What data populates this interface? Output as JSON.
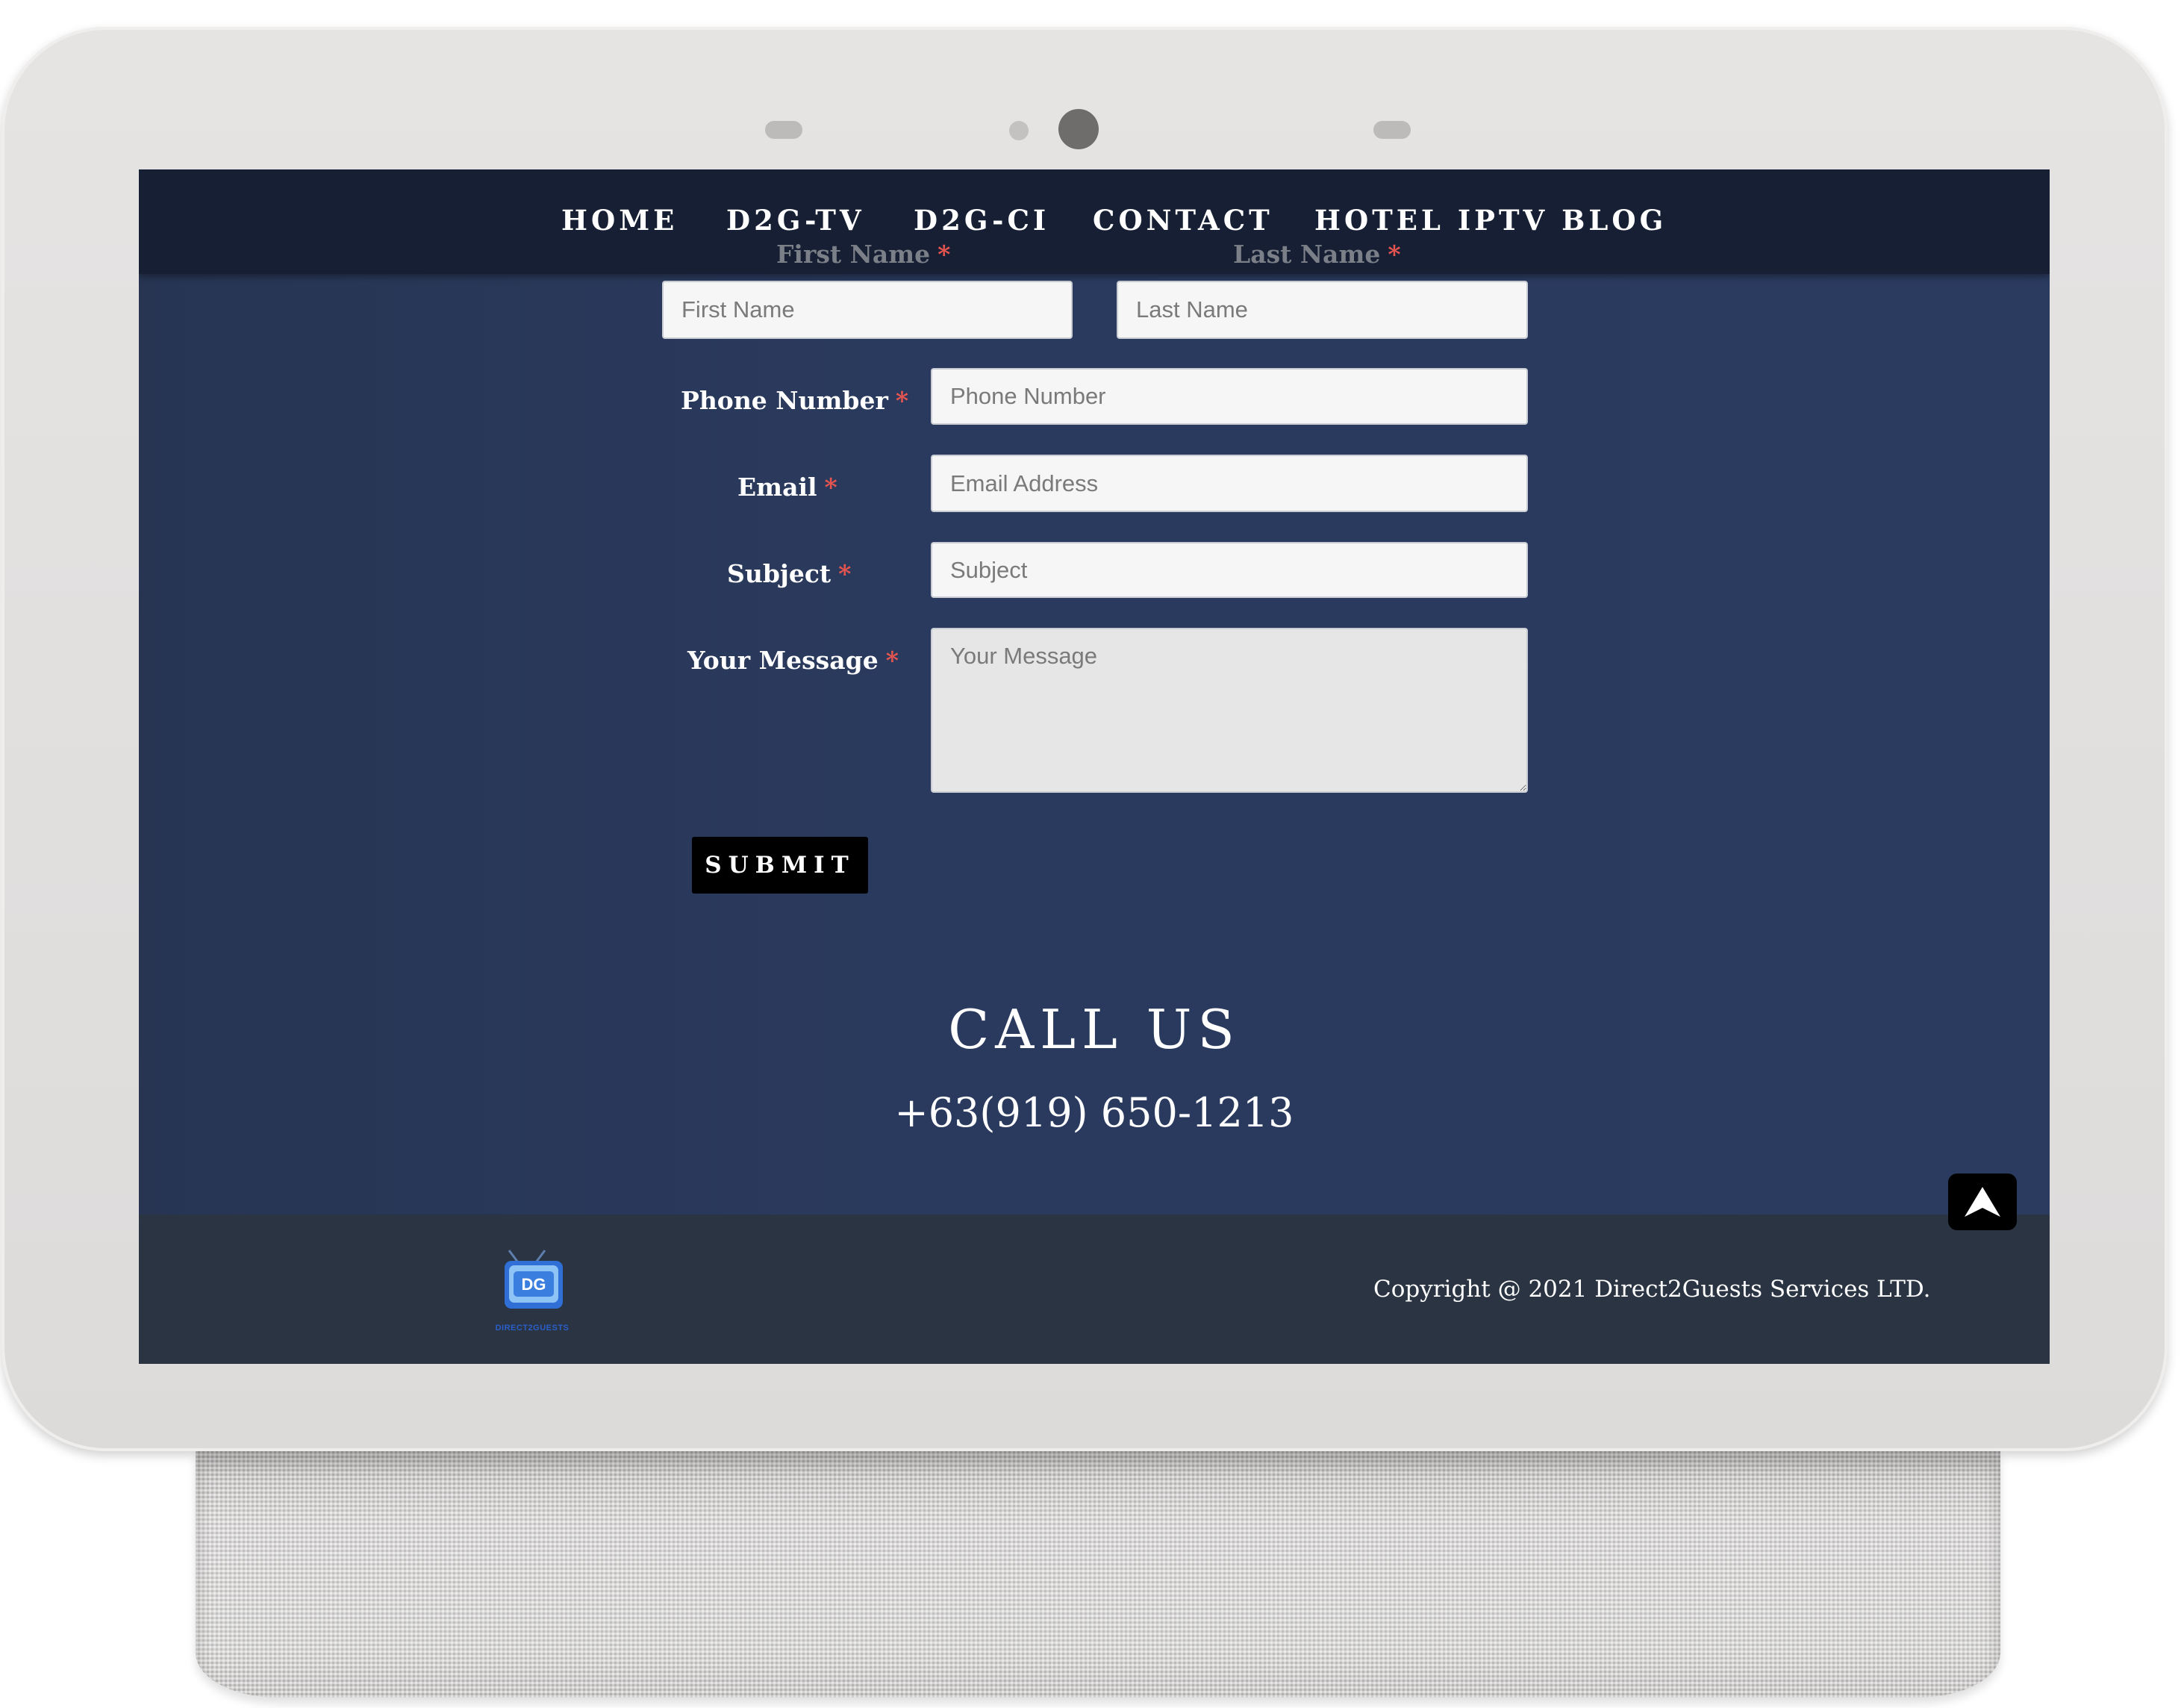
{
  "nav": {
    "items": [
      {
        "label": "HOME"
      },
      {
        "label": "D2G-TV"
      },
      {
        "label": "D2G-CI"
      },
      {
        "label": "CONTACT"
      },
      {
        "label": "HOTEL IPTV BLOG"
      }
    ]
  },
  "form": {
    "first_name": {
      "label": "First Name",
      "required": "*",
      "placeholder": "First Name"
    },
    "last_name": {
      "label": "Last Name",
      "required": "*",
      "placeholder": "Last Name"
    },
    "phone": {
      "label": "Phone Number",
      "required": "*",
      "placeholder": "Phone Number"
    },
    "email": {
      "label": "Email",
      "required": "*",
      "placeholder": "Email Address"
    },
    "subject": {
      "label": "Subject",
      "required": "*",
      "placeholder": "Subject"
    },
    "message": {
      "label": "Your Message",
      "required": "*",
      "placeholder": "Your Message"
    },
    "submit_label": "SUBMIT"
  },
  "call": {
    "title": "CALL US",
    "phone": "+63(919) 650-1213"
  },
  "footer": {
    "logo_text": "DIRECT2GUESTS",
    "copyright": "Copyright @ 2021 Direct2Guests Services LTD."
  },
  "icons": {
    "scroll_top": "arrow-up-icon",
    "logo": "tv-logo-icon"
  },
  "colors": {
    "nav_bg": "#161f33",
    "content_bg": "#2a3a5e",
    "footer_bg": "#2a3442",
    "required": "#e6544f",
    "button_bg": "#000000"
  }
}
